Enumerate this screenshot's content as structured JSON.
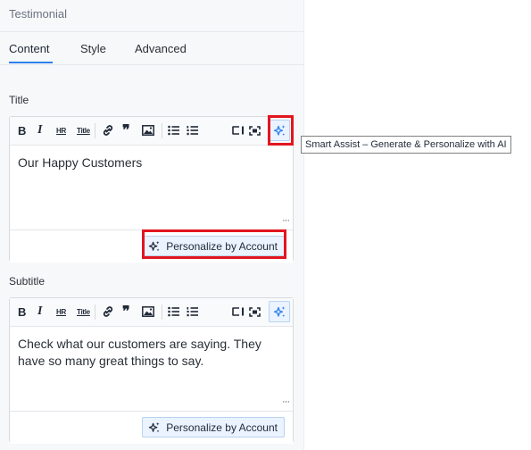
{
  "panel": {
    "title": "Testimonial"
  },
  "tabs": [
    {
      "label": "Content",
      "active": true
    },
    {
      "label": "Style",
      "active": false
    },
    {
      "label": "Advanced",
      "active": false
    }
  ],
  "toolbar": {
    "icons": [
      "bold-icon",
      "italic-icon",
      "hr-icon",
      "title-icon",
      "link-icon",
      "quote-icon",
      "image-icon",
      "bullet-list-icon",
      "numbered-list-icon",
      "expand-icon",
      "fullscreen-icon",
      "smart-assist-icon"
    ],
    "bold": "B",
    "italic": "I",
    "hr": "HR",
    "title": "Title",
    "quote": "❞"
  },
  "fields": {
    "title": {
      "label": "Title",
      "value": "Our Happy Customers",
      "personalize_label": "Personalize by Account"
    },
    "subtitle": {
      "label": "Subtitle",
      "value": "Check what our customers are saying. They have so many great things to say.",
      "personalize_label": "Personalize by Account"
    }
  },
  "tooltip": {
    "text": "Smart Assist – Generate & Personalize with AI"
  },
  "colors": {
    "accent": "#2f80ed",
    "highlight": "#e2161f",
    "button_bg": "#eaf3ff"
  }
}
